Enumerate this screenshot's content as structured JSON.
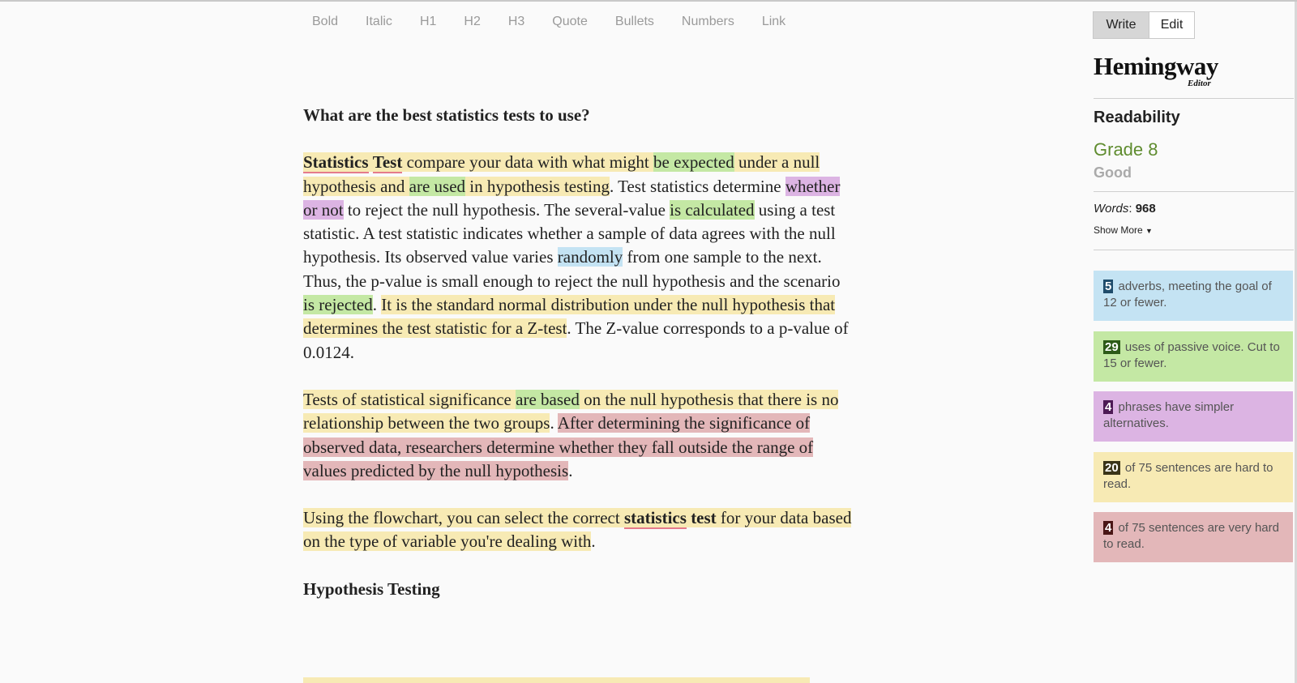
{
  "toolbar": {
    "bold": "Bold",
    "italic": "Italic",
    "h1": "H1",
    "h2": "H2",
    "h3": "H3",
    "quote": "Quote",
    "bullets": "Bullets",
    "numbers": "Numbers",
    "link": "Link"
  },
  "mode": {
    "write": "Write",
    "edit": "Edit",
    "active": "Write"
  },
  "logo": {
    "main": "Hemingway",
    "sub": "Editor"
  },
  "readability": {
    "title": "Readability",
    "grade": "Grade 8",
    "verdict": "Good",
    "words_label": "Words",
    "words_count": "968",
    "show_more": "Show More"
  },
  "stats": {
    "adverbs": {
      "count": "5",
      "text": "adverbs, meeting the goal of 12 or fewer."
    },
    "passive": {
      "count": "29",
      "text": "uses of passive voice. Cut to 15 or fewer."
    },
    "complex": {
      "count": "4",
      "text": "phrases have simpler alternatives."
    },
    "hard": {
      "count": "20",
      "text": "of 75 sentences are hard to read."
    },
    "very_hard": {
      "count": "4",
      "text": "of 75 sentences are very hard to read."
    }
  },
  "colors": {
    "hard": "#f7eab4",
    "very_hard": "#e3b7b9",
    "passive": "#c4e8a4",
    "complex": "#dcb4e3",
    "adverb": "#c4e3f3",
    "grade": "#5f8c2f"
  },
  "document": {
    "heading1": "What are the best statistics tests to use?",
    "p1": {
      "s1a": "Statistics",
      "s1b": "Test",
      "s1c": " compare your data with what might ",
      "s1d": "be expected",
      "s1e": " under a null hypothesis and ",
      "s1f": "are used",
      "s1g": " in hypothesis testing",
      "s2a": ". Test statistics determine ",
      "s2b": "whether or not",
      "s2c": " to reject the null hypothesis. The several-value ",
      "s3a": "is calculated",
      "s3b": " using a test statistic. A test statistic indicates whether a sample of data agrees with the null hypothesis. Its observed value varies ",
      "s4a": "randomly",
      "s4b": " from one sample to the next. Thus, the p-value is small enough to reject the null hypothesis and the scenario ",
      "s5a": "is rejected",
      "s5b": ". ",
      "s6": "It is the standard normal distribution under the null hypothesis that determines the test statistic for a Z-test",
      "s7": ". The Z-value corresponds to a p-value of 0.0124."
    },
    "p2": {
      "s1a": "Tests of statistical significance ",
      "s1b": "are based",
      "s1c": " on the null hypothesis that there is no relationship between the two groups",
      "s1d": ". ",
      "s2": "After determining the significance of observed data, researchers determine whether they fall outside the range of values predicted by the null hypothesis",
      "s3": "."
    },
    "p3": {
      "a": "Using the flowchart, you can select the correct ",
      "b": "statistics",
      "c": " test",
      "d": " for your data based on the type of variable you're dealing with",
      "e": "."
    },
    "heading2": "Hypothesis Testing"
  }
}
